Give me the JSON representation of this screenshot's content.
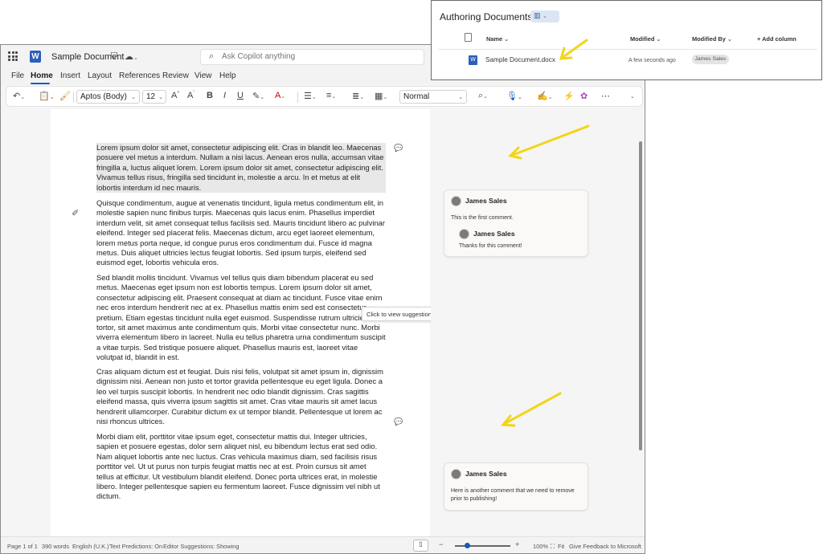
{
  "word": {
    "doc_title": "Sample Document",
    "search_placeholder": "Ask Copilot anything",
    "menu": [
      "File",
      "Home",
      "Insert",
      "Layout",
      "References",
      "Review",
      "View",
      "Help"
    ],
    "ribbon": {
      "font": "Aptos (Body)",
      "size": "12",
      "bold": "B",
      "italic": "I",
      "underline": "U",
      "style": "Normal"
    },
    "paragraphs": [
      "Lorem ipsum dolor sit amet, consectetur adipiscing elit. Cras in blandit leo. Maecenas posuere vel metus a interdum. Nullam a nisi lacus. Aenean eros nulla, accumsan vitae fringilla a, luctus aliquet lorem. Lorem ipsum dolor sit amet, consectetur adipiscing elit. Vivamus tellus risus, fringilla sed tincidunt in, molestie a arcu. In et metus at elit lobortis interdum id nec mauris.",
      "Quisque condimentum, augue at venenatis tincidunt, ligula metus condimentum elit, in molestie sapien nunc finibus turpis. Maecenas quis lacus enim. Phasellus imperdiet interdum velit, sit amet consequat tellus facilisis sed. Mauris tincidunt libero ac pulvinar eleifend. Integer sed placerat felis. Maecenas dictum, arcu eget laoreet elementum, lorem metus porta neque, id congue purus eros condimentum dui. Fusce id magna metus. Duis aliquet ultricies lectus feugiat lobortis. Sed ipsum turpis, eleifend sed euismod eget, lobortis vehicula eros.",
      "Sed blandit mollis tincidunt. Vivamus vel tellus quis diam bibendum placerat eu sed metus. Maecenas eget ipsum non est lobortis tempus. Lorem ipsum dolor sit amet, consectetur adipiscing elit. Praesent consequat at diam ac tincidunt. Fusce vitae enim nec eros interdum hendrerit nec at ex. Phasellus mattis enim sed est consectetur pretium. Etiam egestas tincidunt nulla eget euismod. Suspendisse rutrum ultricies tortor, sit amet maximus ante condimentum quis. Morbi vitae consectetur nunc. Morbi viverra elementum libero in laoreet. Nulla eu tellus pharetra urna condimentum suscipit a vitae turpis. Sed tristique posuere aliquet. Phasellus mauris est, laoreet vitae volutpat id, blandit in est.",
      "Cras aliquam dictum est et feugiat. Duis nisi felis, volutpat sit amet ipsum in, dignissim dignissim nisi. Aenean non justo et tortor gravida pellentesque eu eget ligula. Donec a leo vel turpis suscipit lobortis. In hendrerit nec odio blandit dignissim. Cras sagittis eleifend massa, quis viverra ipsum sagittis sit amet. Cras vitae mauris sit amet lacus hendrerit ullamcorper. Curabitur dictum ex ut tempor blandit. Pellentesque ut lorem ac nisi rhoncus ultrices.",
      "Morbi diam elit, porttitor vitae ipsum eget, consectetur mattis dui. Integer ultricies, sapien et posuere egestas, dolor sem aliquet nisl, eu bibendum lectus erat sed odio. Nam aliquet lobortis ante nec luctus. Cras vehicula maximus diam, sed facilisis risus porttitor vel. Ut ut purus non turpis feugiat mattis nec at est. Proin cursus sit amet tellus at efficitur. Ut vestibulum blandit eleifend. Donec porta ultrices erat, in molestie libero. Integer pellentesque sapien eu fermentum laoreet. Fusce dignissim vel nibh ut dictum."
    ],
    "tooltip": "Click to view suggestions",
    "comments": [
      {
        "author": "James Sales",
        "text": "This is the first comment.",
        "reply_author": "James Sales",
        "reply_text": "Thanks for this comment!"
      },
      {
        "author": "James Sales",
        "text": "Here is another comment that we need to remove prior to publishing!"
      }
    ],
    "status": {
      "page": "Page 1 of 1",
      "words": "390 words",
      "language": "English (U.K.)",
      "predictions": "Text Predictions: On",
      "editor": "Editor Suggestions: Showing",
      "zoom": "100%",
      "fit": "Fit",
      "feedback": "Give Feedback to Microsoft"
    }
  },
  "sharepoint": {
    "title": "Authoring Documents",
    "columns": {
      "name": "Name",
      "modified": "Modified",
      "modified_by": "Modified By",
      "add_column": "+ Add column"
    },
    "row": {
      "name": "Sample Document.docx",
      "modified": "A few seconds ago",
      "modified_by": "James Sales"
    }
  },
  "colors": {
    "accent": "#185abd",
    "annotation_arrow": "#f2d51a"
  }
}
